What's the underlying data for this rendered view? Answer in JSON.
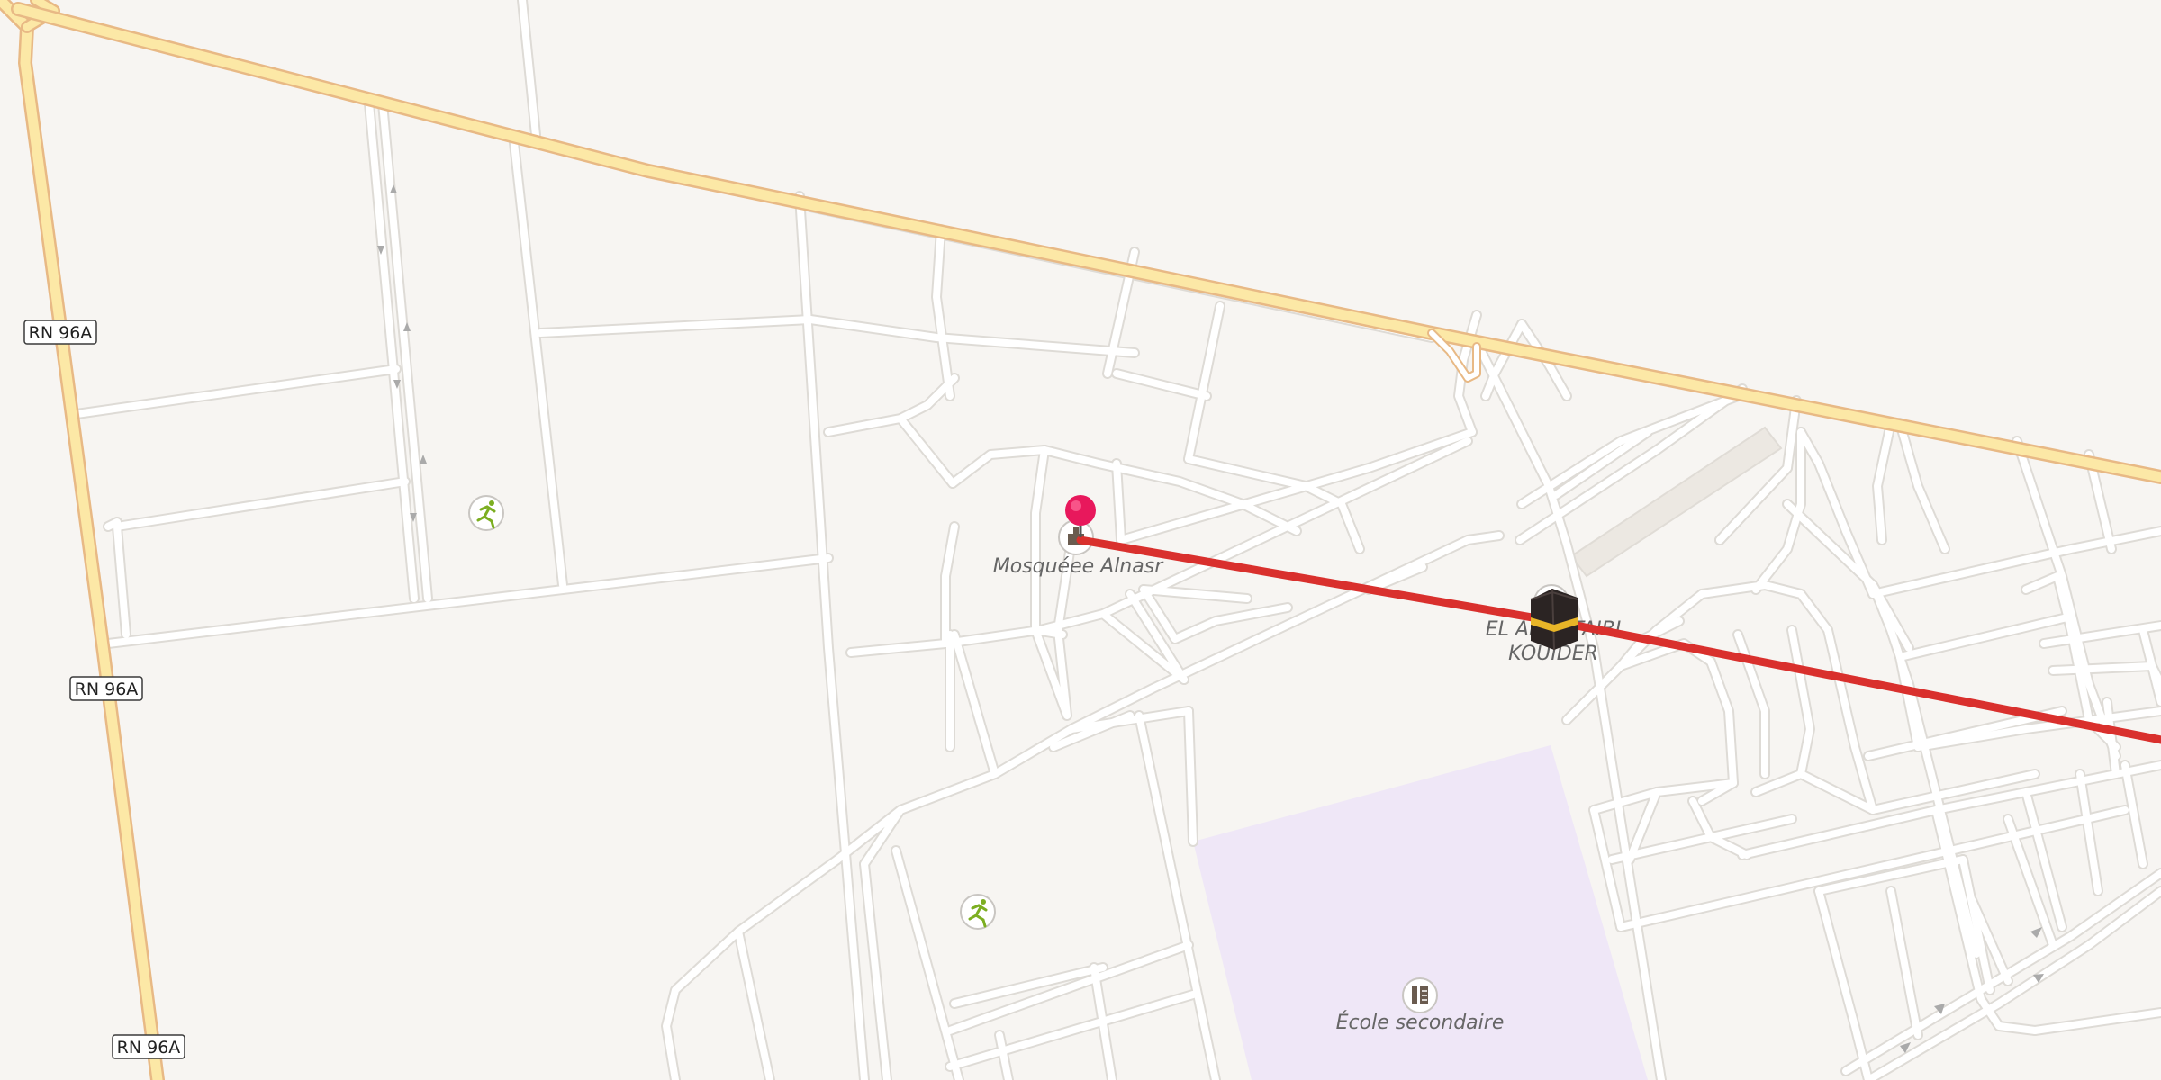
{
  "map": {
    "road_labels": [
      {
        "id": "rn96a-1",
        "text": "RN 96A"
      },
      {
        "id": "rn96a-2",
        "text": "RN 96A"
      },
      {
        "id": "rn96a-3",
        "text": "RN 96A"
      }
    ],
    "poi_labels": {
      "mosque": "Mosquéee Alnasr",
      "school_name_line1": "EL AMIR TAIBI",
      "school_name_line2": "KOUIDER",
      "secondary_school": "École secondaire"
    },
    "icons": {
      "sport_1": "running-person-icon",
      "sport_2": "running-person-icon",
      "mosque": "mosque-icon",
      "school": "school-icon",
      "secondary_school": "school-icon",
      "location_pin": "map-pin-icon",
      "kaaba": "kaaba-icon"
    },
    "colors": {
      "background": "#f7f5f2",
      "main_road": "#fce8a6",
      "main_road_casing": "#e8b985",
      "street": "#ffffff",
      "street_casing": "#dedbd6",
      "school_area": "#efe7f7",
      "route_line": "#d9302d",
      "pin": "#e8185c",
      "sport_icon": "#7cae21"
    }
  }
}
